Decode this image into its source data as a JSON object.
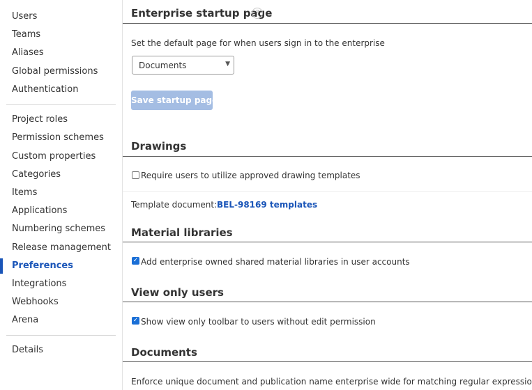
{
  "sidebar": {
    "group1": [
      "Users",
      "Teams",
      "Aliases",
      "Global permissions",
      "Authentication"
    ],
    "group2": [
      "Project roles",
      "Permission schemes",
      "Custom properties",
      "Categories",
      "Items",
      "Applications",
      "Numbering schemes",
      "Release management",
      "Preferences",
      "Integrations",
      "Webhooks",
      "Arena"
    ],
    "group3": [
      "Details"
    ],
    "active": "Preferences"
  },
  "startup": {
    "title": "Enterprise startup page",
    "help_icon": "?",
    "description": "Set the default page for when users sign in to the enterprise",
    "select_value": "Documents",
    "save_label": "Save startup page"
  },
  "drawings": {
    "title": "Drawings",
    "checkbox_label": "Require users to utilize approved drawing templates",
    "checked": false,
    "template_label": "Template document:",
    "template_link": "BEL-98169 templates"
  },
  "materials": {
    "title": "Material libraries",
    "checkbox_label": "Add enterprise owned shared material libraries in user accounts",
    "checked": true
  },
  "viewonly": {
    "title": "View only users",
    "checkbox_label": "Show view only toolbar to users without edit permission",
    "checked": true
  },
  "documents": {
    "title": "Documents",
    "description": "Enforce unique document and publication name enterprise wide for matching regular expression"
  },
  "colors": {
    "accent": "#1a55b8",
    "button_disabled": "#a4bde3",
    "checkbox": "#1a6fd6"
  }
}
